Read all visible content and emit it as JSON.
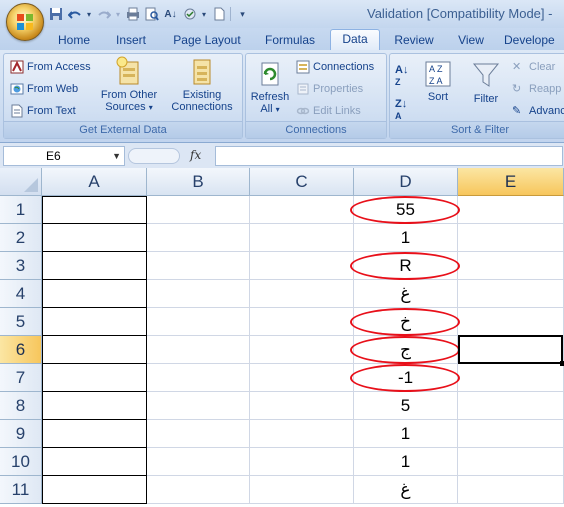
{
  "window": {
    "title": "Validation  [Compatibility Mode] -"
  },
  "quick_access": [
    "save-icon",
    "undo-icon",
    "redo-icon",
    "print-icon",
    "print-preview-icon",
    "sort-icon",
    "spelling-icon",
    "new-icon",
    "customize-icon"
  ],
  "tabs": [
    "Home",
    "Insert",
    "Page Layout",
    "Formulas",
    "Data",
    "Review",
    "View",
    "Develope"
  ],
  "active_tab": "Data",
  "ribbon": {
    "get_external_data": {
      "label": "Get External Data",
      "from_access": "From Access",
      "from_web": "From Web",
      "from_text": "From Text",
      "from_other_sources_1": "From Other",
      "from_other_sources_2": "Sources",
      "existing_connections_1": "Existing",
      "existing_connections_2": "Connections"
    },
    "connections": {
      "label": "Connections",
      "refresh_all_1": "Refresh",
      "refresh_all_2": "All",
      "connections": "Connections",
      "properties": "Properties",
      "edit_links": "Edit Links"
    },
    "sort_filter": {
      "label": "Sort & Filter",
      "sort": "Sort",
      "filter": "Filter",
      "clear": "Clear",
      "reapply": "Reapp",
      "advanced": "Advanc"
    }
  },
  "formula_bar": {
    "name_box": "E6",
    "fx_label": "fx",
    "formula": ""
  },
  "columns": [
    "A",
    "B",
    "C",
    "D",
    "E"
  ],
  "selected_column": "E",
  "rows": [
    "1",
    "2",
    "3",
    "4",
    "5",
    "6",
    "7",
    "8",
    "9",
    "10",
    "11"
  ],
  "selected_row": "6",
  "column_d_values": [
    "55",
    "1",
    "R",
    "غ",
    "خ",
    "ج",
    "-1",
    "5",
    "1",
    "1",
    "غ"
  ],
  "invalid_circled_rows": [
    1,
    3,
    5,
    6,
    7
  ],
  "active_cell": "E6",
  "colors": {
    "circle": "#e8101a",
    "header_selected": "#f7c65c",
    "ribbon": "#c9daf0"
  }
}
